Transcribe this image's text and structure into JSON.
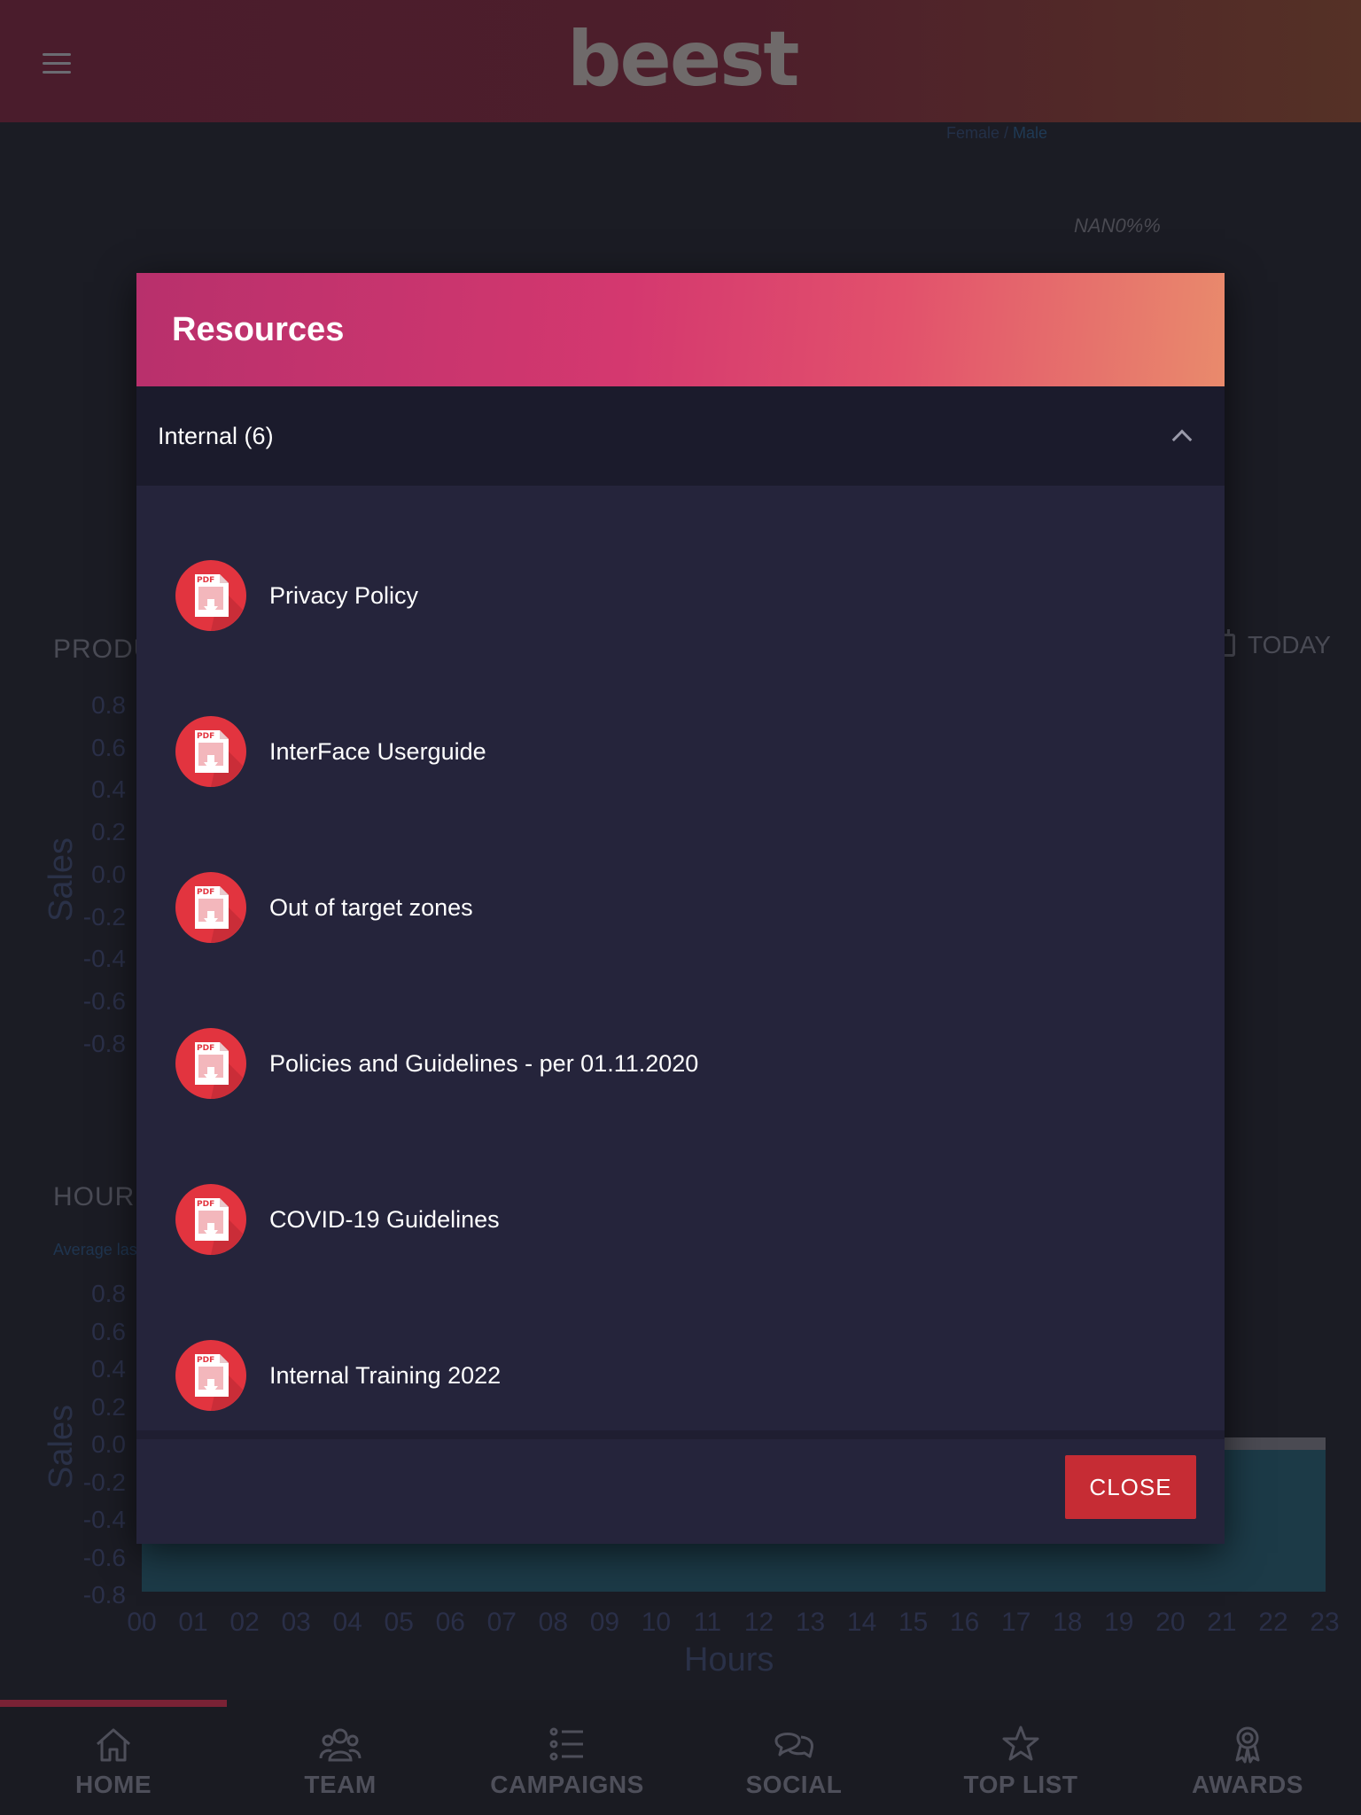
{
  "header": {
    "logo_text": "beest"
  },
  "background": {
    "gender_female": "Female",
    "gender_separator": " / ",
    "gender_male": "Male",
    "percent_text": "NAN0%%",
    "section1_title": "PRODU",
    "today_label": "TODAY",
    "section2_title": "HOURL",
    "section2_subtitle": "Average las",
    "y_axis_label": "Sales",
    "x_axis_label": "Hours",
    "y_ticks": [
      "0.8",
      "0.6",
      "0.4",
      "0.2",
      "0.0",
      "-0.2",
      "-0.4",
      "-0.6",
      "-0.8"
    ],
    "hours": [
      "00",
      "01",
      "02",
      "03",
      "04",
      "05",
      "06",
      "07",
      "08",
      "09",
      "10",
      "11",
      "12",
      "13",
      "14",
      "15",
      "16",
      "17",
      "18",
      "19",
      "20",
      "21",
      "22",
      "23"
    ]
  },
  "modal": {
    "title": "Resources",
    "group_title": "Internal (6)",
    "items": [
      {
        "label": "Privacy Policy"
      },
      {
        "label": "InterFace Userguide"
      },
      {
        "label": "Out of target zones"
      },
      {
        "label": "Policies and Guidelines - per 01.11.2020"
      },
      {
        "label": "COVID-19 Guidelines"
      },
      {
        "label": "Internal Training 2022"
      }
    ],
    "close_label": "CLOSE",
    "pdf_badge": "PDF"
  },
  "nav": {
    "items": [
      {
        "label": "HOME",
        "icon": "home-icon"
      },
      {
        "label": "TEAM",
        "icon": "team-icon"
      },
      {
        "label": "CAMPAIGNS",
        "icon": "list-icon"
      },
      {
        "label": "SOCIAL",
        "icon": "chat-icon"
      },
      {
        "label": "TOP LIST",
        "icon": "star-icon"
      },
      {
        "label": "AWARDS",
        "icon": "award-icon"
      }
    ]
  },
  "colors": {
    "accent_red": "#c62c34",
    "modal_bg": "#25243b",
    "header_gradient_start": "#b8306c",
    "header_gradient_end": "#e98a6c"
  }
}
